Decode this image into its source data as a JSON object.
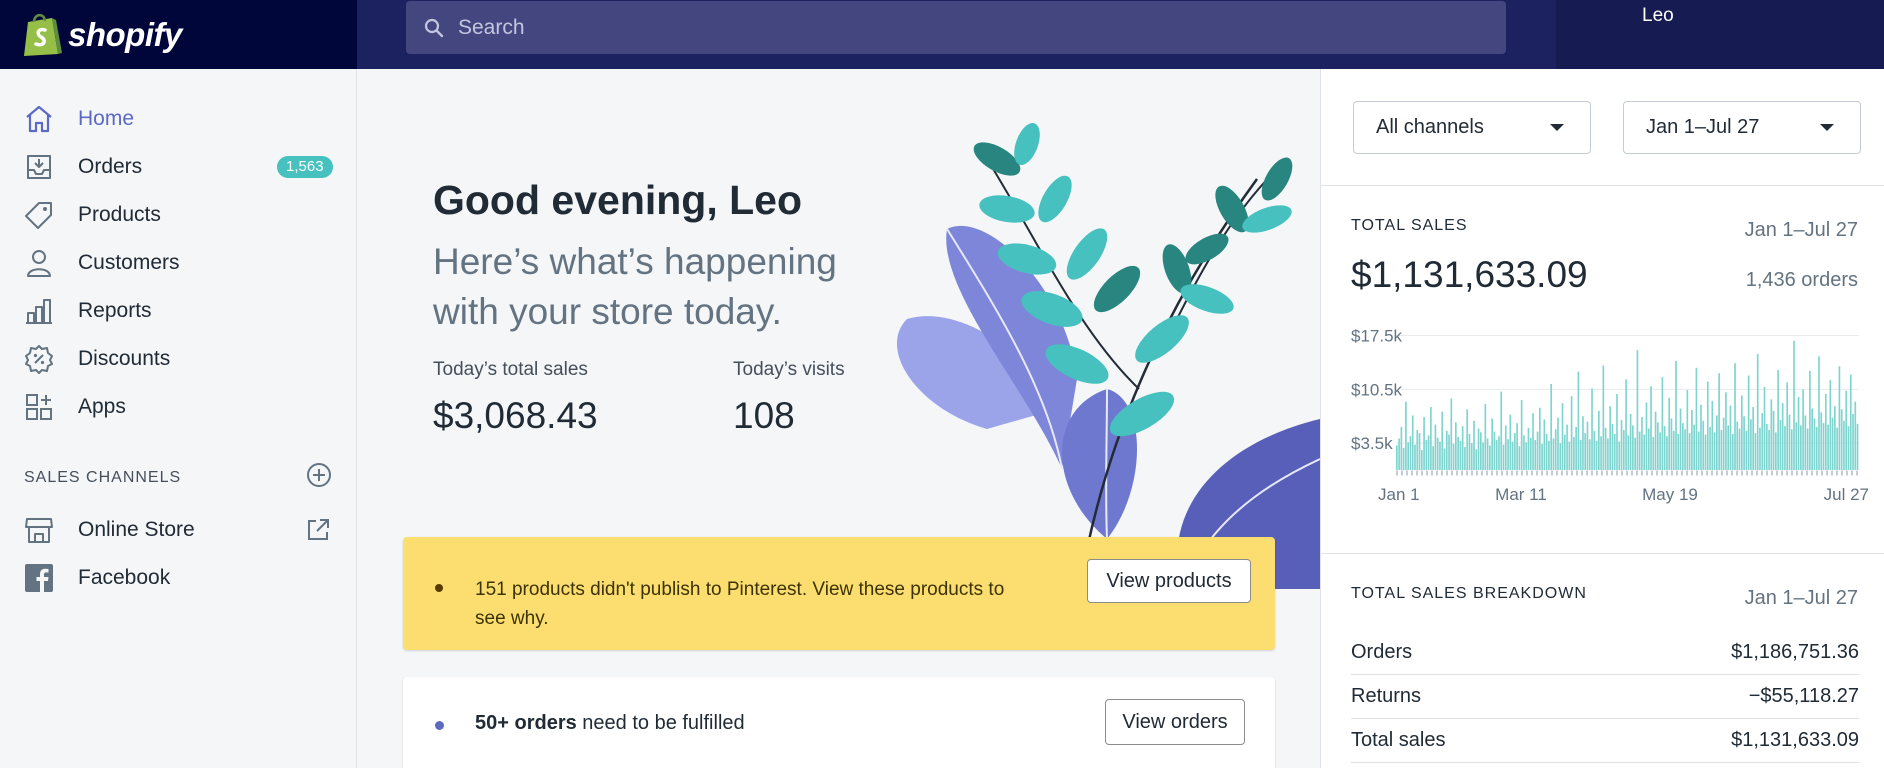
{
  "topbar": {
    "brand_name": "shopify",
    "search_placeholder": "Search",
    "user_name": "Leo"
  },
  "sidebar": {
    "items": [
      {
        "label": "Home",
        "icon": "home-icon",
        "active": true
      },
      {
        "label": "Orders",
        "icon": "orders-icon",
        "badge": "1,563"
      },
      {
        "label": "Products",
        "icon": "tag-icon"
      },
      {
        "label": "Customers",
        "icon": "person-icon"
      },
      {
        "label": "Reports",
        "icon": "bar-chart-icon"
      },
      {
        "label": "Discounts",
        "icon": "discount-icon"
      },
      {
        "label": "Apps",
        "icon": "apps-icon"
      }
    ],
    "sales_channels_title": "SALES CHANNELS",
    "channels": [
      {
        "label": "Online Store",
        "icon": "store-icon"
      },
      {
        "label": "Facebook",
        "icon": "facebook-icon"
      }
    ]
  },
  "main": {
    "greeting": "Good evening, Leo",
    "subtitle_line1": "Here’s what’s happening",
    "subtitle_line2": "with your store today.",
    "todays_sales_label": "Today’s total sales",
    "todays_sales_value": "$3,068.43",
    "todays_visits_label": "Today’s visits",
    "todays_visits_value": "108",
    "banner_text": "151 products didn't publish to Pinterest. View these products to see why.",
    "banner_button": "View products",
    "orders_bold": "50+ orders",
    "orders_rest": " need to be fulfilled",
    "orders_button": "View orders"
  },
  "right_panel": {
    "channel_select": "All channels",
    "date_select": "Jan 1–Jul 27",
    "total_sales_title": "TOTAL SALES",
    "total_sales_range": "Jan 1–Jul 27",
    "total_sales_value": "$1,131,633.09",
    "orders_count": "1,436 orders",
    "breakdown_title": "TOTAL SALES BREAKDOWN",
    "breakdown_range": "Jan 1–Jul 27",
    "breakdown": [
      {
        "label": "Orders",
        "value": "$1,186,751.36"
      },
      {
        "label": "Returns",
        "value": "−$55,118.27"
      },
      {
        "label": "Total sales",
        "value": "$1,131,633.09"
      }
    ]
  },
  "colors": {
    "topbar": "#1c2260",
    "brand_bg": "#000639",
    "accent": "#5c6ac4",
    "badge": "#47c1bf",
    "banner": "#fcde70",
    "chart_bar": "#7fd4cf"
  },
  "chart_data": {
    "type": "bar",
    "title": "TOTAL SALES",
    "x_tick_labels": [
      "Jan 1",
      "Mar 11",
      "May 19",
      "Jul 27"
    ],
    "y_tick_labels": [
      "$17.5k",
      "$10.5k",
      "$3.5k"
    ],
    "y_ticks": [
      17500,
      10500,
      3500
    ],
    "ylim": [
      0,
      19000
    ],
    "grid": true,
    "series": [
      {
        "values": [
          3200,
          4100,
          5600,
          2900,
          8900,
          3600,
          4400,
          7100,
          3300,
          5200,
          4800,
          2600,
          6900,
          3900,
          4500,
          8200,
          3100,
          5900,
          4200,
          3700,
          7600,
          2800,
          5100,
          4600,
          9300,
          3400,
          6200,
          4300,
          3800,
          5700,
          3000,
          7900,
          4700,
          3500,
          6400,
          2700,
          5400,
          4900,
          3600,
          8600,
          4100,
          3200,
          6700,
          5000,
          3900,
          4400,
          10200,
          3300,
          5800,
          4000,
          7200,
          3700,
          4800,
          6100,
          3100,
          9100,
          4500,
          3600,
          5500,
          4200,
          7400,
          3900,
          5000,
          8100,
          3400,
          6600,
          4700,
          3800,
          11200,
          4100,
          5300,
          6800,
          3500,
          8700,
          4600,
          5900,
          3700,
          9600,
          4300,
          5600,
          12800,
          3900,
          7000,
          4800,
          6300,
          4000,
          10600,
          5100,
          3800,
          7700,
          4400,
          13600,
          5500,
          4100,
          8300,
          6000,
          4700,
          9900,
          3700,
          6500,
          5200,
          11800,
          4500,
          7300,
          5800,
          4200,
          15600,
          5000,
          6900,
          4600,
          8800,
          5400,
          10900,
          4300,
          7600,
          6200,
          4900,
          12100,
          5700,
          4400,
          9400,
          6700,
          5100,
          14200,
          4700,
          8000,
          6100,
          5300,
          10400,
          4800,
          7800,
          5900,
          13300,
          5000,
          8500,
          6400,
          4600,
          11500,
          5600,
          9000,
          4900,
          7100,
          12600,
          5200,
          6800,
          10100,
          5800,
          8400,
          4700,
          13900,
          6300,
          5400,
          9700,
          7000,
          5100,
          12300,
          6600,
          8200,
          4800,
          15100,
          5500,
          7400,
          10800,
          6000,
          5200,
          9200,
          7700,
          4900,
          13000,
          6500,
          8700,
          5700,
          11400,
          7200,
          5300,
          16800,
          6200,
          9500,
          5800,
          10500,
          7100,
          5400,
          12900,
          8000,
          6700,
          5600,
          14800,
          7500,
          6100,
          9900,
          5900,
          11700,
          6800,
          8300,
          5500,
          13500,
          7900,
          6400,
          10300,
          5700,
          12400,
          7300,
          8900,
          6000
        ]
      }
    ]
  },
  "illustration": {
    "name": "leaves-illustration"
  }
}
